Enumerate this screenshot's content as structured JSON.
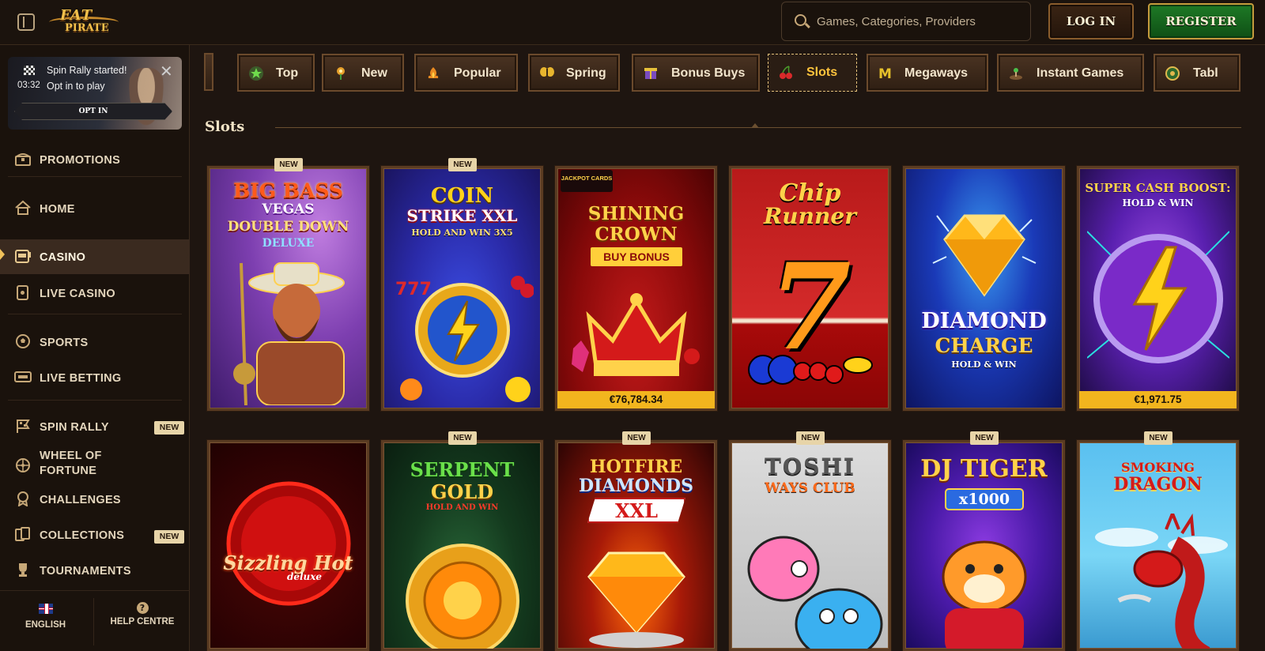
{
  "header": {
    "logo_line1": "FAT",
    "logo_line2": "PIRATE",
    "search_placeholder": "Games, Categories, Providers",
    "login_label": "LOG IN",
    "register_label": "REGISTER"
  },
  "rally": {
    "title": "Spin Rally started!",
    "timer": "03:32",
    "subtitle": "Opt in to play",
    "optin_label": "OPT IN",
    "close_label": "✕"
  },
  "sidebar": {
    "items": [
      {
        "label": "PROMOTIONS",
        "icon": "treasure-chest-icon"
      },
      {
        "label": "HOME",
        "icon": "home-icon"
      },
      {
        "label": "CASINO",
        "icon": "slot-machine-icon",
        "active": true
      },
      {
        "label": "LIVE CASINO",
        "icon": "cards-icon"
      },
      {
        "label": "SPORTS",
        "icon": "football-icon"
      },
      {
        "label": "LIVE BETTING",
        "icon": "live-icon"
      },
      {
        "label": "SPIN RALLY",
        "icon": "checkered-flag-icon",
        "badge": "NEW"
      },
      {
        "label": "WHEEL OF",
        "label2": "FORTUNE",
        "icon": "wheel-icon"
      },
      {
        "label": "CHALLENGES",
        "icon": "medal-icon"
      },
      {
        "label": "COLLECTIONS",
        "icon": "cards-collection-icon",
        "badge": "NEW"
      },
      {
        "label": "TOURNAMENTS",
        "icon": "trophy-icon"
      }
    ],
    "footer": {
      "language": "ENGLISH",
      "help": "HELP CENTRE",
      "help_glyph": "?"
    }
  },
  "categories": [
    {
      "label": "Top",
      "icon": "star-icon"
    },
    {
      "label": "New",
      "icon": "new-icon"
    },
    {
      "label": "Popular",
      "icon": "popular-icon"
    },
    {
      "label": "Spring",
      "icon": "butterfly-icon"
    },
    {
      "label": "Bonus Buys",
      "icon": "bonus-buy-icon"
    },
    {
      "label": "Slots",
      "icon": "cherries-icon",
      "active": true
    },
    {
      "label": "Megaways",
      "icon": "megaways-icon"
    },
    {
      "label": "Instant Games",
      "icon": "instant-icon"
    },
    {
      "label": "Tabl",
      "icon": "table-icon"
    }
  ],
  "section": {
    "title": "Slots"
  },
  "games": [
    {
      "name": "BIG BASS VEGAS DOUBLE DOWN DELUXE",
      "line1": "BIG BASS",
      "line2": "VEGAS",
      "line3": "DOUBLE DOWN",
      "line4": "DELUXE",
      "badge": "NEW"
    },
    {
      "name": "COIN STRIKE XXL HOLD AND WIN 3X5",
      "line1": "COIN",
      "line2": "STRIKE XXL",
      "line3": "HOLD AND WIN 3X5",
      "badge": "NEW"
    },
    {
      "name": "SHINING CROWN BUY BONUS",
      "line1": "SHINING",
      "line2": "CROWN",
      "line3": "BUY BONUS",
      "tag": "JACKPOT CARDS",
      "jackpot": "€76,784.34"
    },
    {
      "name": "Chip Runner",
      "line1": "Chip",
      "line2": "Runner",
      "symbol": "7"
    },
    {
      "name": "DIAMOND CHARGE HOLD & WIN",
      "line1": "DIAMOND",
      "line2": "CHARGE",
      "line3": "HOLD & WIN"
    },
    {
      "name": "SUPER CASH BOOST: HOLD & WIN",
      "line1": "SUPER CASH BOOST:",
      "line2": "HOLD & WIN",
      "jackpot": "€1,971.75"
    },
    {
      "name": "Sizzling Hot deluxe",
      "line1": "Sizzling Hot",
      "line2": "deluxe"
    },
    {
      "name": "SERPENT GOLD HOLD AND WIN",
      "line1": "SERPENT",
      "line2": "GOLD",
      "line3": "HOLD AND WIN",
      "badge": "NEW"
    },
    {
      "name": "HOTFIRE DIAMONDS XXL",
      "line1": "HOTFIRE",
      "line2": "DIAMONDS",
      "line3": "XXL",
      "badge": "NEW"
    },
    {
      "name": "TOSHI WAYS CLUB",
      "line1": "TOSHI",
      "line2": "WAYS CLUB",
      "badge": "NEW"
    },
    {
      "name": "DJ TIGER x1000",
      "line1": "DJ TIGER",
      "line2": "x1000",
      "badge": "NEW"
    },
    {
      "name": "SMOKING DRAGON",
      "line1": "SMOKING",
      "line2": "DRAGON",
      "badge": "NEW"
    }
  ]
}
